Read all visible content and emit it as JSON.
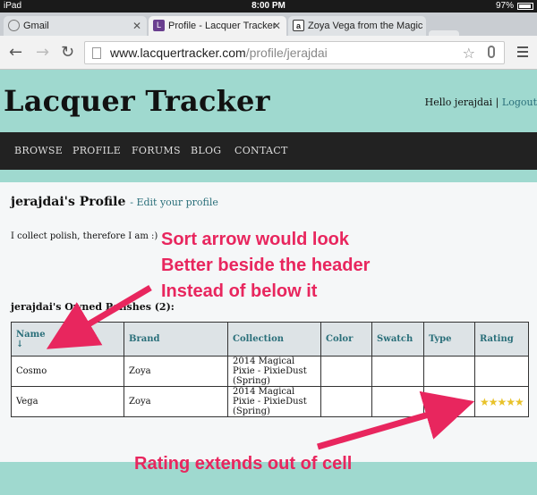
{
  "status_bar": {
    "device": "iPad",
    "time": "8:00 PM",
    "battery": "97%"
  },
  "tabs": [
    {
      "title": "Gmail",
      "favicon": "globe-icon"
    },
    {
      "title": "Profile - Lacquer Tracker",
      "favicon": "lacquer-tracker-icon"
    },
    {
      "title": "Zoya Vega from the Magic",
      "favicon": "amazon-icon"
    }
  ],
  "browser": {
    "url_domain": "www.lacquertracker.com",
    "url_path": "/profile/jerajdai"
  },
  "site": {
    "title": "Lacquer Tracker",
    "greeting": "Hello jerajdai |",
    "logout": "Logout",
    "nav": [
      "BROWSE",
      "PROFILE",
      "FORUMS",
      "BLOG",
      "CONTACT"
    ]
  },
  "profile": {
    "heading": "jerajdai's Profile",
    "edit_link": "- Edit your profile",
    "bio": "I collect polish, therefore I am :)",
    "owned_heading": "jerajdai's Owned Polishes (2):"
  },
  "table": {
    "headers": [
      "Name",
      "Brand",
      "Collection",
      "Color",
      "Swatch",
      "Type",
      "Rating"
    ],
    "sort_arrow": "↓",
    "rows": [
      {
        "name": "Cosmo",
        "brand": "Zoya",
        "collection": "2014 Magical Pixie - PixieDust (Spring)",
        "color": "",
        "swatch": "",
        "type": "",
        "rating": ""
      },
      {
        "name": "Vega",
        "brand": "Zoya",
        "collection": "2014 Magical Pixie - PixieDust (Spring)",
        "color": "",
        "swatch": "",
        "type": "",
        "rating": "★★★★★"
      }
    ]
  },
  "annotations": {
    "note1": [
      "Sort arrow would look",
      "Better beside the header",
      "Instead of below it"
    ],
    "note2": "Rating extends out of cell",
    "color": "#e8265e"
  }
}
